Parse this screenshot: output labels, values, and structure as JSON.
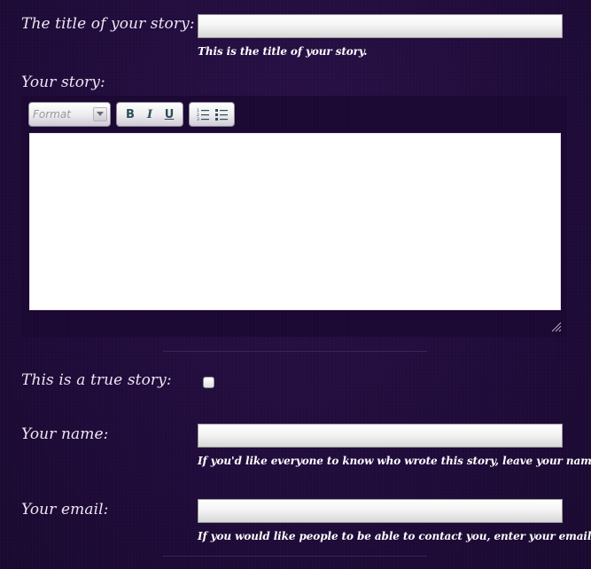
{
  "form": {
    "title_field": {
      "label": "The title of your story:",
      "value": "",
      "hint": "This is the title of your story."
    },
    "story_field": {
      "label": "Your story:",
      "toolbar": {
        "format_label": "Format",
        "bold_label": "B",
        "italic_label": "I",
        "underline_label": "U"
      },
      "value": ""
    },
    "true_story_field": {
      "label": "This is a true story:",
      "checked": false
    },
    "name_field": {
      "label": "Your name:",
      "value": "",
      "hint": "If you'd like everyone to know who wrote this story, leave your name."
    },
    "email_field": {
      "label": "Your email:",
      "value": "",
      "hint": "If you would like people to be able to contact you, enter your email."
    }
  },
  "icons": {
    "dropdown": "chevron-down-icon",
    "ordered_list": "numbered-list-icon",
    "unordered_list": "bulleted-list-icon",
    "resize": "resize-grip-icon",
    "checkbox": "checkbox-icon"
  },
  "colors": {
    "background": "#200c3b",
    "editor_background": "#1b0833",
    "label_text": "#eee6f2",
    "toolbar_icon": "#2d4f58"
  }
}
